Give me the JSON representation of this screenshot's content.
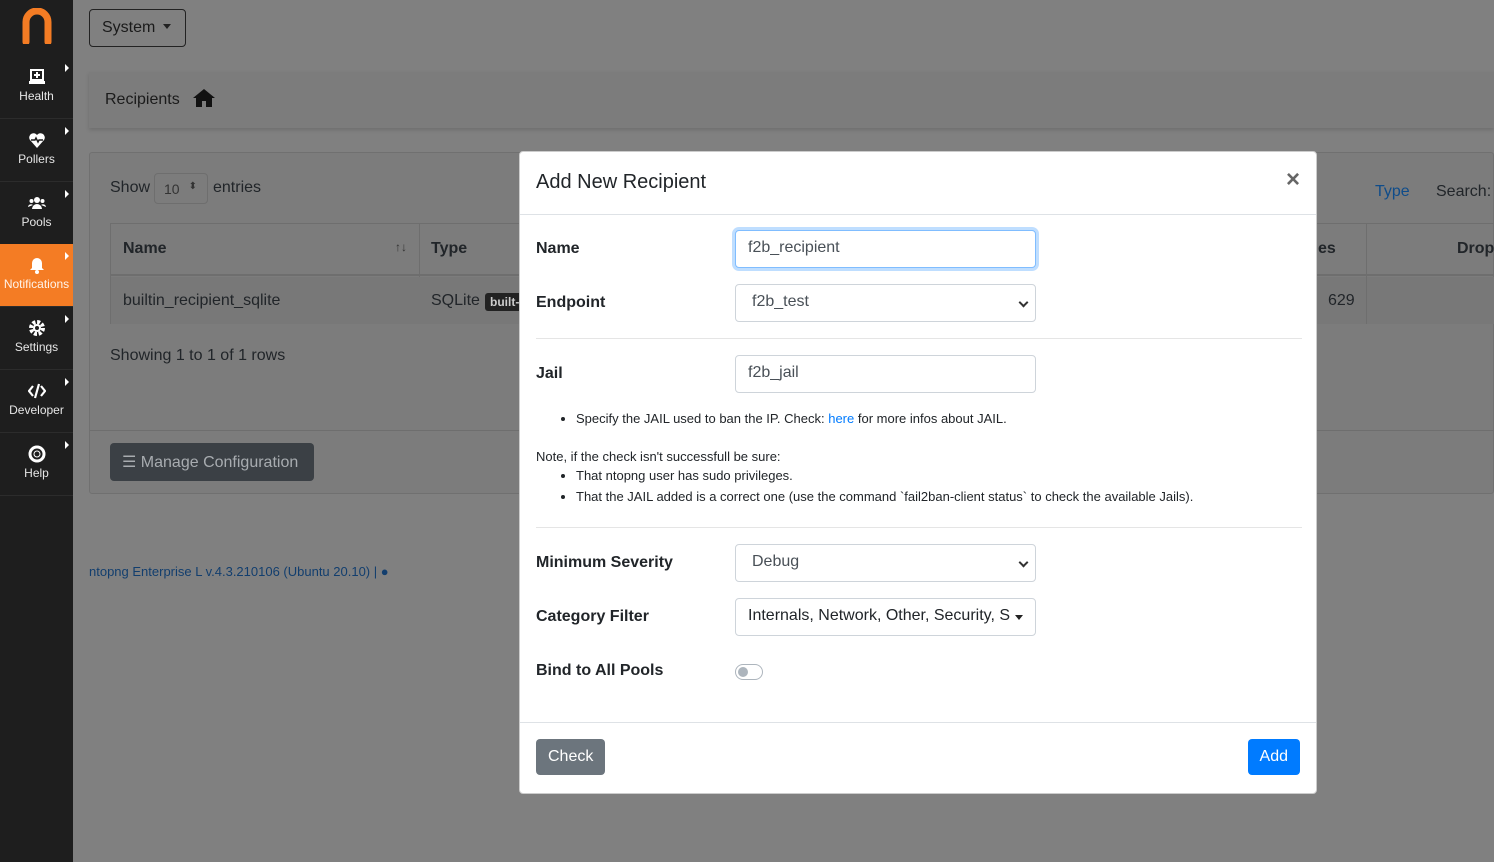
{
  "sidebar": {
    "items": [
      {
        "label": "Health",
        "icon": "laptop-medical-icon"
      },
      {
        "label": "Pollers",
        "icon": "heartbeat-icon"
      },
      {
        "label": "Pools",
        "icon": "users-icon"
      },
      {
        "label": "Notifications",
        "icon": "bell-icon",
        "active": true
      },
      {
        "label": "Settings",
        "icon": "cog-icon"
      },
      {
        "label": "Developer",
        "icon": "code-icon"
      },
      {
        "label": "Help",
        "icon": "life-ring-icon"
      }
    ]
  },
  "header": {
    "system_label": "System",
    "breadcrumb": "Recipients"
  },
  "table": {
    "show": "Show",
    "entries_value": "10",
    "entries": "entries",
    "type_filter": "Type",
    "search_label": "Search:",
    "columns": [
      "Name",
      "Type",
      "es",
      "Drop"
    ],
    "rows": [
      {
        "name": "builtin_recipient_sqlite",
        "type": "SQLite",
        "badge": "built-",
        "count": "629"
      }
    ],
    "info": "Showing 1 to 1 of 1 rows",
    "manage_button": "Manage Configuration"
  },
  "footer": {
    "version": "ntopng Enterprise L v.4.3.210106 (Ubuntu 20.10) |"
  },
  "modal": {
    "title": "Add New Recipient",
    "close": "×",
    "name_label": "Name",
    "name_value": "f2b_recipient",
    "endpoint_label": "Endpoint",
    "endpoint_value": "f2b_test",
    "jail_label": "Jail",
    "jail_value": "f2b_jail",
    "hint_pre": "Specify the JAIL used to ban the IP. Check: ",
    "hint_link": "here",
    "hint_post": " for more infos about JAIL.",
    "note": "Note, if the check isn't successfull be sure:",
    "note_items": [
      "That ntopng user has sudo privileges.",
      "That the JAIL added is a correct one (use the command `fail2ban-client status` to check the available Jails)."
    ],
    "severity_label": "Minimum Severity",
    "severity_value": "Debug",
    "category_label": "Category Filter",
    "category_value": "Internals, Network, Other, Security, S",
    "pools_label": "Bind to All Pools",
    "pools_enabled": false,
    "check_button": "Check",
    "add_button": "Add"
  },
  "colors": {
    "accent": "#f47c24",
    "primary": "#007bff",
    "secondary": "#6c757d"
  }
}
